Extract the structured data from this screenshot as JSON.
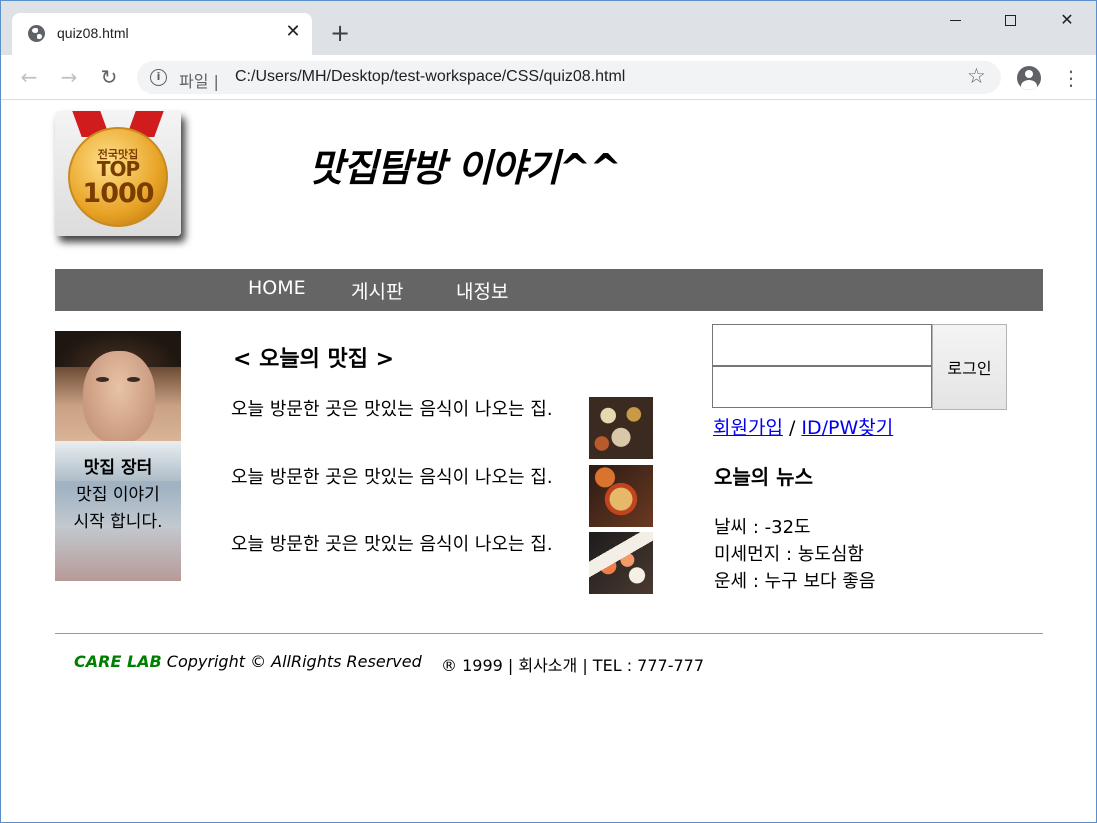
{
  "browser": {
    "tab_title": "quiz08.html",
    "tab_close": "✕",
    "new_tab": "+",
    "scheme_label": "파일 |",
    "url": "C:/Users/MH/Desktop/test-workspace/CSS/quiz08.html",
    "icons": {
      "favicon": "globe-icon",
      "back": "arrow-left-icon",
      "forward": "arrow-right-icon",
      "reload": "reload-icon",
      "info": "info-icon",
      "bookmark": "star-icon",
      "account": "account-icon",
      "menu": "more-vert-icon",
      "minimize": "minimize-icon",
      "maximize": "maximize-icon",
      "close": "close-icon"
    },
    "glyphs": {
      "back": "←",
      "forward": "→",
      "reload": "↻",
      "info": "i",
      "star": "☆",
      "menu": "⋮",
      "close": "✕"
    }
  },
  "header": {
    "logo": {
      "line1": "전국맛집",
      "line2": "TOP",
      "line3": "1000"
    },
    "title": "맛집탐방 이야기^^"
  },
  "nav": {
    "items": [
      "HOME",
      "게시판",
      "내정보"
    ]
  },
  "banner": {
    "caption_bold": "맛집 장터",
    "caption_line2": "맛집 이야기",
    "caption_line3": "시작 합니다."
  },
  "main": {
    "heading": "< 오늘의 맛집 >",
    "items": [
      {
        "text": "오늘 방문한 곳은 맛있는 음식이 나오는 집."
      },
      {
        "text": "오늘 방문한 곳은 맛있는 음식이 나오는 집."
      },
      {
        "text": "오늘 방문한 곳은 맛있는 음식이 나오는 집."
      }
    ]
  },
  "login": {
    "id_value": "",
    "pw_value": "",
    "button": "로그인",
    "signup": "회원가입",
    "separator": " / ",
    "find": "ID/PW찾기"
  },
  "news": {
    "title": "오늘의 뉴스",
    "rows": [
      "날씨 : -32도",
      "미세먼지 : 농도심함",
      "운세 : 누구 보다 좋음"
    ]
  },
  "footer": {
    "brand": "CARE LAB",
    "copyright": " Copyright © AllRights Reserved",
    "info": "® 1999 | 회사소개 | TEL : 777-777"
  }
}
